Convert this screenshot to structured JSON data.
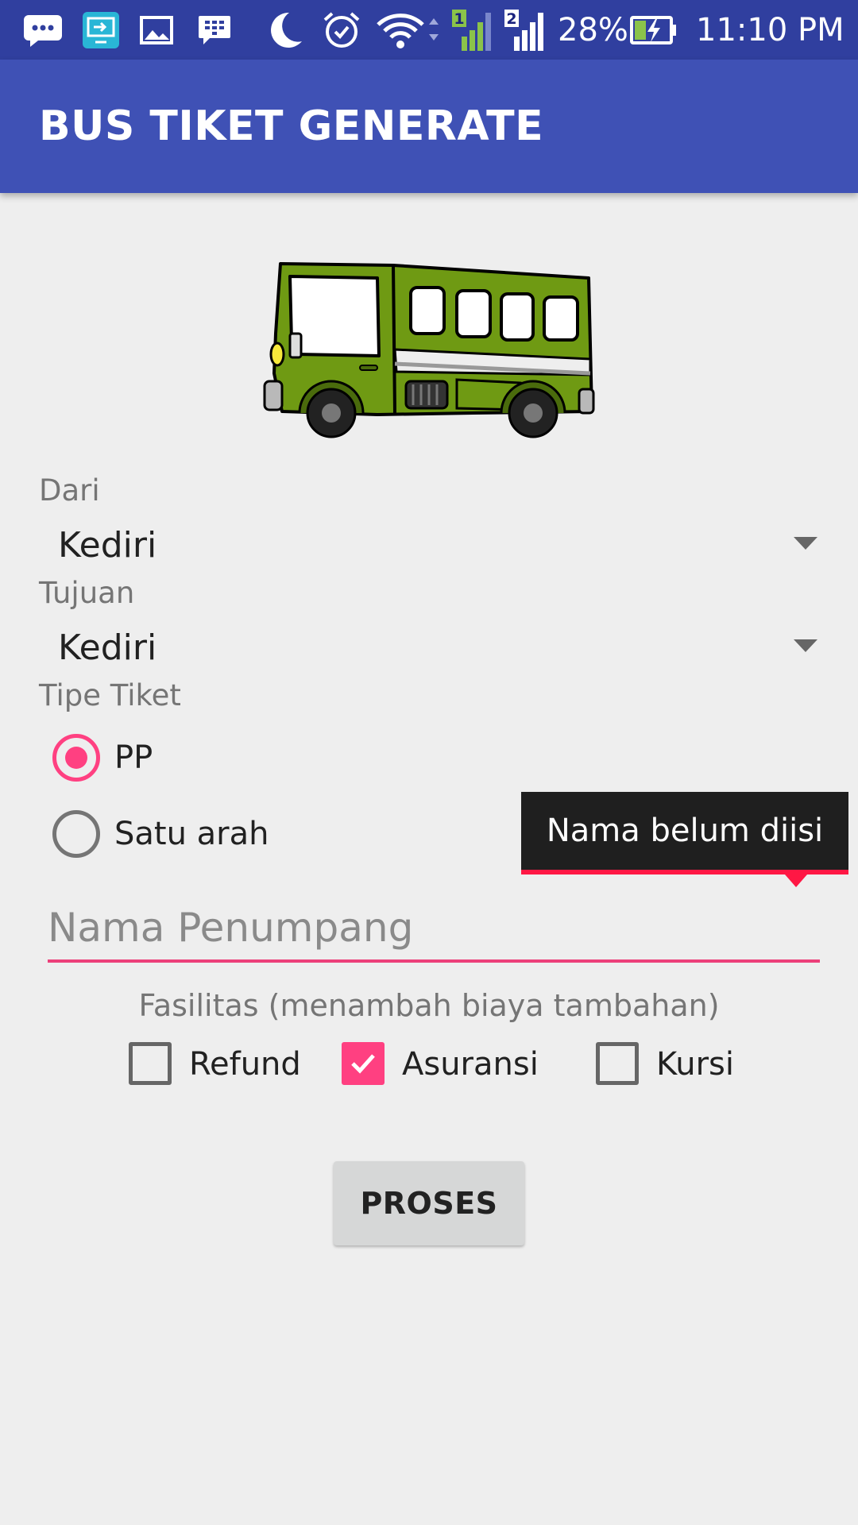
{
  "status_bar": {
    "battery": "28%",
    "time": "11:10 PM",
    "sim1": "1",
    "sim2": "2",
    "icons": [
      "messenger-icon",
      "remote-icon",
      "gallery-icon",
      "bbm-icon",
      "moon-icon",
      "alarm-icon",
      "wifi-icon",
      "signal-sim1-icon",
      "signal-sim2-icon",
      "battery-charging-icon"
    ]
  },
  "app_bar": {
    "title": "BUS TIKET GENERATE"
  },
  "form": {
    "from_label": "Dari",
    "from_value": "Kediri",
    "to_label": "Tujuan",
    "to_value": "Kediri",
    "ticket_type_label": "Tipe Tiket",
    "ticket_types": [
      {
        "label": "PP",
        "selected": true
      },
      {
        "label": "Satu arah",
        "selected": false
      }
    ],
    "name_placeholder": "Nama Penumpang",
    "name_value": "",
    "name_error": "Nama belum diisi",
    "facilities_label": "Fasilitas (menambah biaya tambahan)",
    "facilities": [
      {
        "label": "Refund",
        "checked": false
      },
      {
        "label": "Asuransi",
        "checked": true
      },
      {
        "label": "Kursi",
        "checked": false
      }
    ],
    "submit_label": "PROSES"
  },
  "colors": {
    "status_bar": "#303f9f",
    "app_bar": "#3f51b5",
    "accent": "#ff4081",
    "error": "#ff1744",
    "background": "#eeeeee"
  }
}
